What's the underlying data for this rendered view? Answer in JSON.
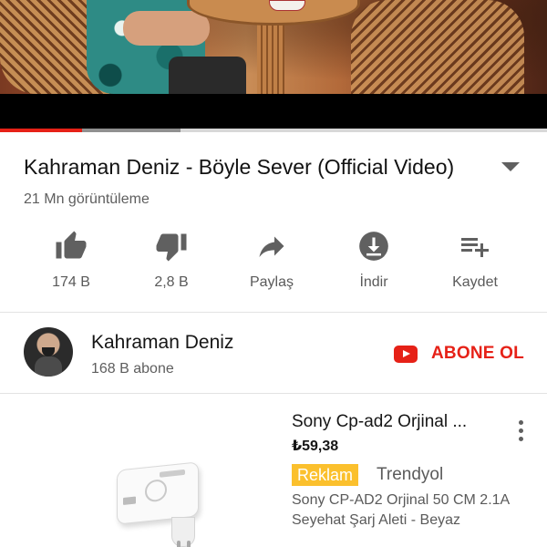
{
  "player": {
    "progress_played_fraction": 0.15,
    "progress_buffered_fraction": 0.33
  },
  "video": {
    "title": "Kahraman Deniz - Böyle Sever (Official Video)",
    "views": "21 Mn görüntüleme"
  },
  "actions": [
    {
      "icon": "thumbs-up-icon",
      "label": "174 B"
    },
    {
      "icon": "thumbs-down-icon",
      "label": "2,8 B"
    },
    {
      "icon": "share-icon",
      "label": "Paylaş"
    },
    {
      "icon": "download-icon",
      "label": "İndir"
    },
    {
      "icon": "playlist-add-icon",
      "label": "Kaydet"
    }
  ],
  "channel": {
    "name": "Kahraman Deniz",
    "subscribers": "168 B abone",
    "subscribe_label": "ABONE OL"
  },
  "ad": {
    "title": "Sony Cp-ad2 Orjinal ...",
    "price": "₺59,38",
    "badge": "Reklam",
    "advertiser": "Trendyol",
    "description": "Sony CP-AD2 Orjinal 50 CM 2.1A Seyehat Şarj Aleti - Beyaz"
  },
  "colors": {
    "accent_red": "#e62117",
    "ad_badge": "#fbc02d"
  }
}
